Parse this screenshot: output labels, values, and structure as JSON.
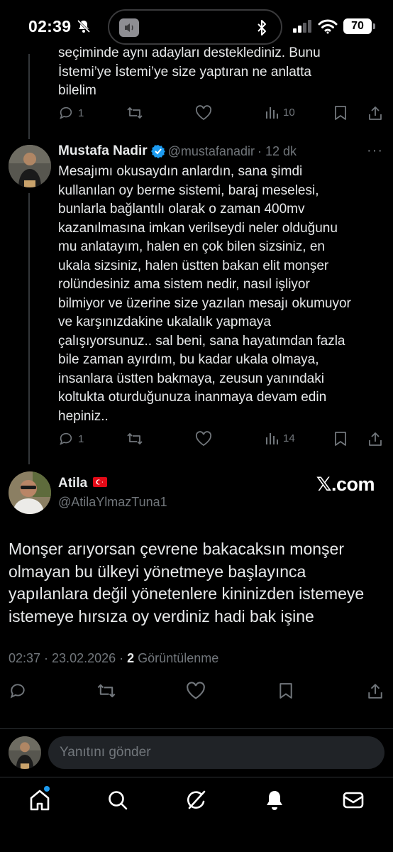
{
  "status": {
    "time": "02:39",
    "battery": "70"
  },
  "prev_tweet": {
    "text": "seçiminde aynı adayları desteklediniz. Bunu\nİstemi’ye İstemi’ye size yaptıran ne anlatta\nbilelim",
    "replies": "1",
    "views": "10"
  },
  "reply_tweet": {
    "name": "Mustafa Nadir",
    "handle": "@mustafanadir",
    "time": "· 12 dk",
    "text": "Mesajımı okusaydın anlardın, sana şimdi\nkullanılan oy berme sistemi, baraj meselesi,\nbunlarla bağlantılı olarak o zaman 400mv\nkazanılmasına imkan verilseydi neler olduğunu\nmu anlatayım, halen en çok bilen sizsiniz, en\nukala sizsiniz, halen üstten bakan elit monşer\nrolündesiniz ama sistem nedir, nasıl işliyor\nbilmiyor ve üzerine size yazılan mesajı okumuyor\nve karşınızdakine ukalalık yapmaya\nçalışıyorsunuz.. sal beni, sana hayatımdan fazla\nbile zaman ayırdım, bu kadar ukala olmaya,\ninsanlara üstten bakmaya, zeusun yanındaki\nkoltukta oturduğunuza inanmaya devam edin\nhepiniz..",
    "replies": "1",
    "views": "14"
  },
  "main_tweet": {
    "name": "Atila",
    "flag": "🇹🇷",
    "handle": "@AtilaYlmazTuna1",
    "source": "𝕏.com",
    "text": "Monşer arıyorsan çevrene bakacaksın monşer\nolmayan bu ülkeyi yönetmeye başlayınca\nyapılanlara değil yönetenlere kininizden istemeye\nistemeye hırsıza oy verdiniz hadi bak işine",
    "date": "02:37 · 23.02.2026 ·",
    "views_count": "2",
    "views_label": "Görüntülenme"
  },
  "reply_bar": {
    "placeholder": "Yanıtını gönder"
  },
  "colors": {
    "accent": "#1d9bf0",
    "muted": "#71767b",
    "flag_red": "#e30a17"
  }
}
